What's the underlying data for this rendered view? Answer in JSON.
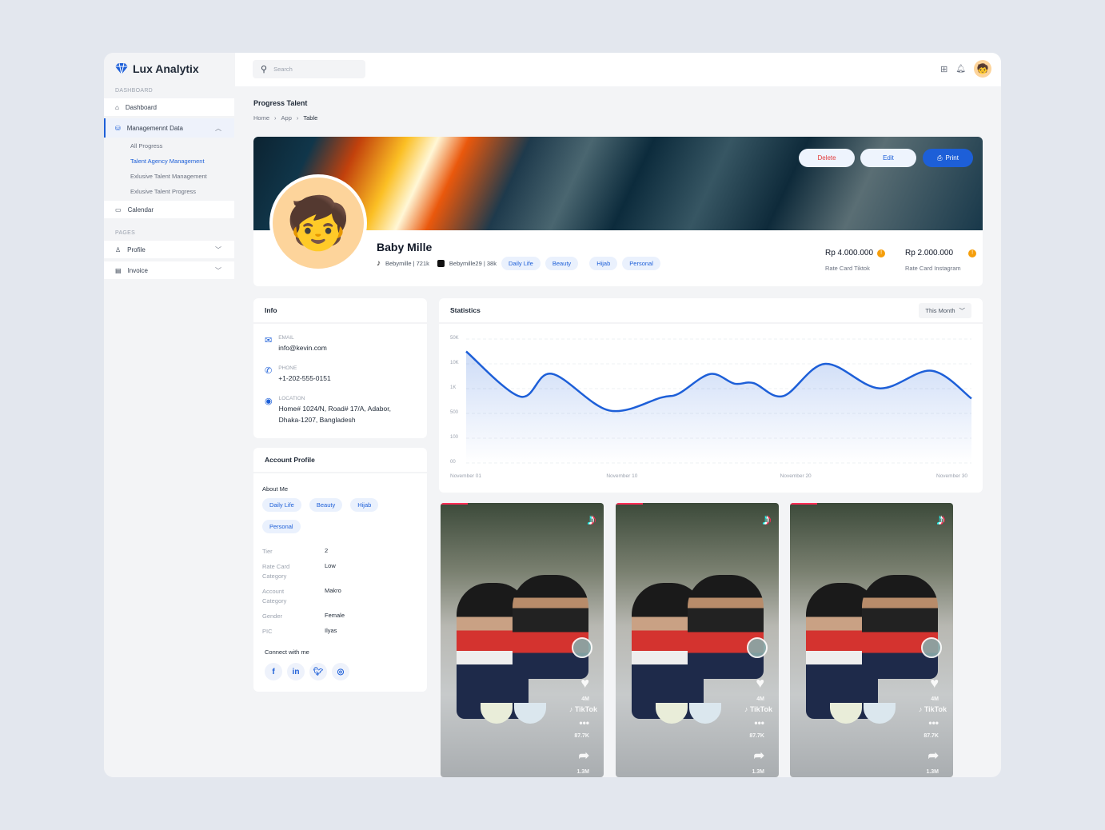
{
  "app": {
    "title": "Lux Analytix"
  },
  "sidebar": {
    "section_dashboard": "DASHBOARD",
    "dashboard": "Dashboard",
    "management": "Managemennt Data",
    "sub_items": [
      "All Progress",
      "Talent Agency Management",
      "Exlusive Talent Management",
      "Exlusive Talent Progress"
    ],
    "calendar": "Calendar",
    "section_pages": "PAGES",
    "profile": "Profile",
    "invoice": "Invoice"
  },
  "header": {
    "search_placeholder": "Search"
  },
  "page": {
    "title": "Progress Talent",
    "breadcrumb": [
      "Home",
      "App",
      "Table"
    ]
  },
  "profile": {
    "delete": "Delete",
    "edit": "Edit",
    "print": "Print",
    "name": "Baby Mille",
    "tiktok": "Bebymille | 721k",
    "instagram": "Bebymille29 | 38k",
    "tags": [
      "Daily Life",
      "Beauty",
      "Hijab",
      "Personal"
    ],
    "rate_tiktok": "Rp 4.000.000",
    "rate_tiktok_label": "Rate Card Tiktok",
    "rate_instagram": "Rp 2.000.000",
    "rate_instagram_label": "Rate Card Instagram",
    "accent": "#1d5fd8"
  },
  "info": {
    "title": "Info",
    "email_label": "EMAIL",
    "email": "info@kevin.com",
    "phone_label": "PHONE",
    "phone": "+1-202-555-0151",
    "location_label": "LOCATION",
    "location_1": "Home# 1024/N, Road# 17/A, Adabor,",
    "location_2": "Dhaka-1207, Bangladesh"
  },
  "account": {
    "title": "Account Profile",
    "about": "About Me",
    "tags": [
      "Daily Life",
      "Beauty",
      "Hijab",
      "Personal"
    ],
    "fields": [
      {
        "label": "Tier",
        "value": "2"
      },
      {
        "label": "Rate Card Category",
        "value": "Low"
      },
      {
        "label": "Account Category",
        "value": "Makro"
      },
      {
        "label": "Gender",
        "value": "Female"
      },
      {
        "label": "PIC",
        "value": "Ilyas"
      }
    ],
    "connect": "Connect with me"
  },
  "statistics": {
    "title": "Statistics",
    "period": "This Month"
  },
  "chart_data": {
    "type": "area",
    "title": "Statistics",
    "y_ticks": [
      "50K",
      "10K",
      "1K",
      "500",
      "100",
      "00"
    ],
    "y_tick_values": [
      50000,
      10000,
      1000,
      500,
      100,
      0
    ],
    "x_ticks": [
      "November 01",
      "November 10",
      "November 20",
      "November 30"
    ],
    "xlim": [
      1,
      30
    ],
    "x": [
      1,
      4.1,
      5.9,
      9.2,
      12.2,
      13.2,
      15,
      16.4,
      17.5,
      19.2,
      21.6,
      24.7,
      27.7,
      30
    ],
    "values": [
      30000,
      840,
      6400,
      560,
      820,
      900,
      6300,
      2800,
      3000,
      850,
      10000,
      1100,
      7500,
      800
    ],
    "grid": true,
    "color": "#1d5fd8"
  },
  "videos": [
    {
      "brand": "TikTok",
      "likes": "4M",
      "comments": "87.7K",
      "shares": "1.3M"
    },
    {
      "brand": "TikTok",
      "likes": "4M",
      "comments": "87.7K",
      "shares": "1.3M"
    },
    {
      "brand": "TikTok",
      "likes": "4M",
      "comments": "87.7K",
      "shares": "1.3M"
    }
  ]
}
